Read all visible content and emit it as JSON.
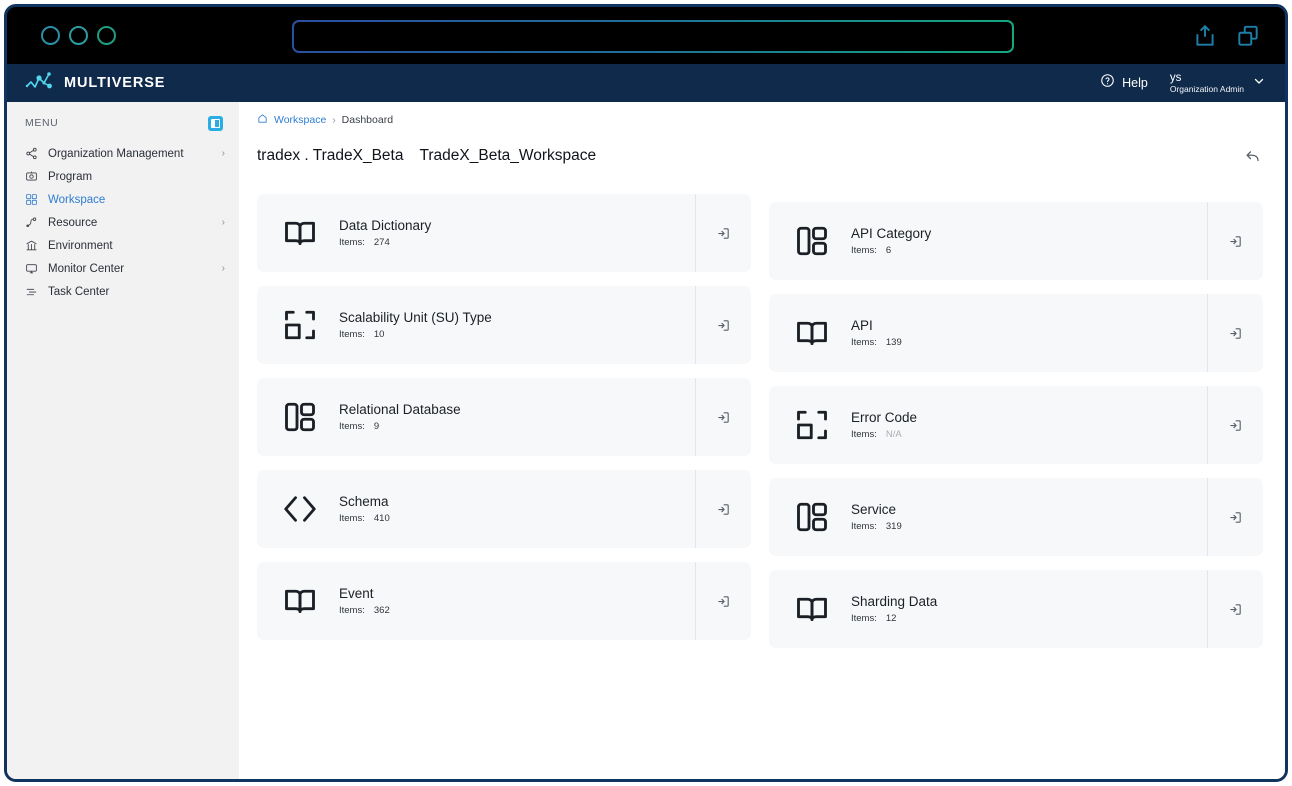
{
  "browser": {
    "traffic_lights": [
      "close",
      "minimize",
      "maximize"
    ],
    "url_value": "",
    "url_placeholder": "",
    "actions": [
      {
        "name": "share-icon",
        "label": "Share"
      },
      {
        "name": "duplicate-tab-icon",
        "label": "Duplicate"
      }
    ]
  },
  "header": {
    "brand": "MULTIVERSE",
    "help_label": "Help",
    "user_name": "ys",
    "user_role": "Organization Admin"
  },
  "sidebar": {
    "menu_label": "MENU",
    "items": [
      {
        "label": "Organization Management",
        "icon": "share-nodes-icon",
        "has_chevron": true,
        "active": false
      },
      {
        "label": "Program",
        "icon": "target-icon",
        "has_chevron": false,
        "active": false
      },
      {
        "label": "Workspace",
        "icon": "grid-apps-icon",
        "has_chevron": false,
        "active": true
      },
      {
        "label": "Resource",
        "icon": "resource-icon",
        "has_chevron": true,
        "active": false
      },
      {
        "label": "Environment",
        "icon": "bank-icon",
        "has_chevron": false,
        "active": false
      },
      {
        "label": "Monitor Center",
        "icon": "monitor-icon",
        "has_chevron": true,
        "active": false
      },
      {
        "label": "Task Center",
        "icon": "tasks-icon",
        "has_chevron": false,
        "active": false
      }
    ],
    "chevron_glyph": "›"
  },
  "main": {
    "breadcrumb": {
      "root": "Workspace",
      "separator": "›",
      "current": "Dashboard"
    },
    "title_prefix": "tradex . TradeX_Beta",
    "title_main": "TradeX_Beta_Workspace",
    "back_icon": "undo-arrow-icon",
    "items_label": "Items:",
    "cards_left": [
      {
        "title": "Data Dictionary",
        "items": "274",
        "icon": "book-icon"
      },
      {
        "title": "Scalability Unit (SU) Type",
        "items": "10",
        "icon": "scan-frame-icon"
      },
      {
        "title": "Relational Database",
        "items": "9",
        "icon": "layout-blocks-icon"
      },
      {
        "title": "Schema",
        "items": "410",
        "icon": "code-brackets-icon"
      },
      {
        "title": "Event",
        "items": "362",
        "icon": "book-icon"
      }
    ],
    "cards_right": [
      {
        "title": "API Category",
        "items": "6",
        "icon": "layout-blocks-icon"
      },
      {
        "title": "API",
        "items": "139",
        "icon": "book-icon"
      },
      {
        "title": "Error Code",
        "items": "N/A",
        "icon": "scan-frame-icon",
        "na": true
      },
      {
        "title": "Service",
        "items": "319",
        "icon": "layout-blocks-icon"
      },
      {
        "title": "Sharding Data",
        "items": "12",
        "icon": "book-icon"
      }
    ],
    "card_action_icon": "enter-arrow-icon"
  },
  "colors": {
    "header_navy": "#102a4c",
    "accent_blue": "#2f7dd1",
    "toggle_blue": "#29ade4",
    "logo_cyan": "#4fd8ee",
    "card_bg": "#f7f8f9",
    "sidebar_bg": "#f2f2f2"
  }
}
